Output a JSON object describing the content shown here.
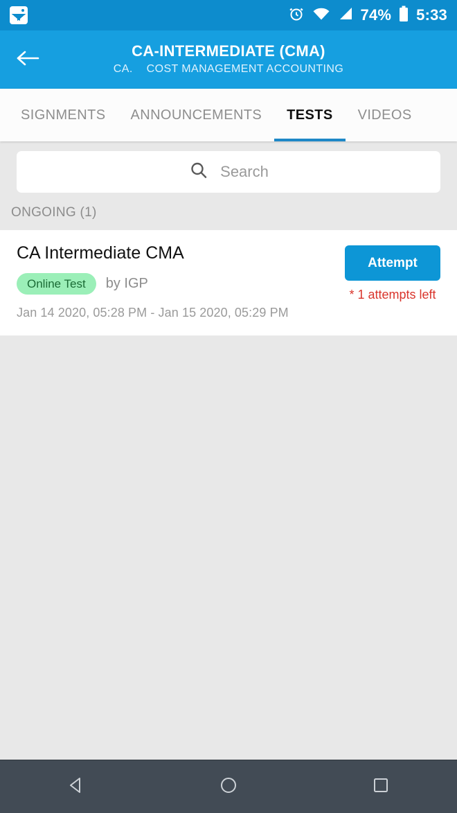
{
  "status_bar": {
    "notification_icon": "photo-icon",
    "alarm_icon": "alarm-clock-icon",
    "wifi_icon": "wifi-icon",
    "signal_icon": "cellular-signal-icon",
    "battery_percent": "74%",
    "battery_icon": "battery-icon",
    "time": "5:33",
    "background": "#0d8ccd"
  },
  "app_bar": {
    "back_icon": "back-arrow-icon",
    "title": "CA-INTERMEDIATE (CMA)",
    "subtitle_code": "CA.",
    "subtitle_name": "COST MANAGEMENT ACCOUNTING",
    "background": "#169fe0"
  },
  "tabs": {
    "items": [
      {
        "label": "SIGNMENTS",
        "active": false
      },
      {
        "label": "ANNOUNCEMENTS",
        "active": false
      },
      {
        "label": "TESTS",
        "active": true
      },
      {
        "label": "VIDEOS",
        "active": false
      }
    ],
    "active_index": 2,
    "indicator_color": "#1e88c7"
  },
  "search": {
    "icon": "search-icon",
    "placeholder": "Search",
    "value": ""
  },
  "section": {
    "label": "ONGOING (1)"
  },
  "tests": [
    {
      "title": "CA Intermediate CMA",
      "badge": "Online Test",
      "badge_bg": "#9befb8",
      "badge_color": "#1a6b35",
      "author": "by IGP",
      "dates": "Jan 14 2020, 05:28 PM - Jan 15 2020, 05:29 PM",
      "action_label": "Attempt",
      "action_color": "#0d96d6",
      "attempts_note": "* 1 attempts left",
      "attempts_note_color": "#d9342b"
    }
  ],
  "nav_bar": {
    "back_icon": "nav-back-triangle-icon",
    "home_icon": "nav-home-circle-icon",
    "recents_icon": "nav-recents-square-icon",
    "background": "#424b55"
  }
}
